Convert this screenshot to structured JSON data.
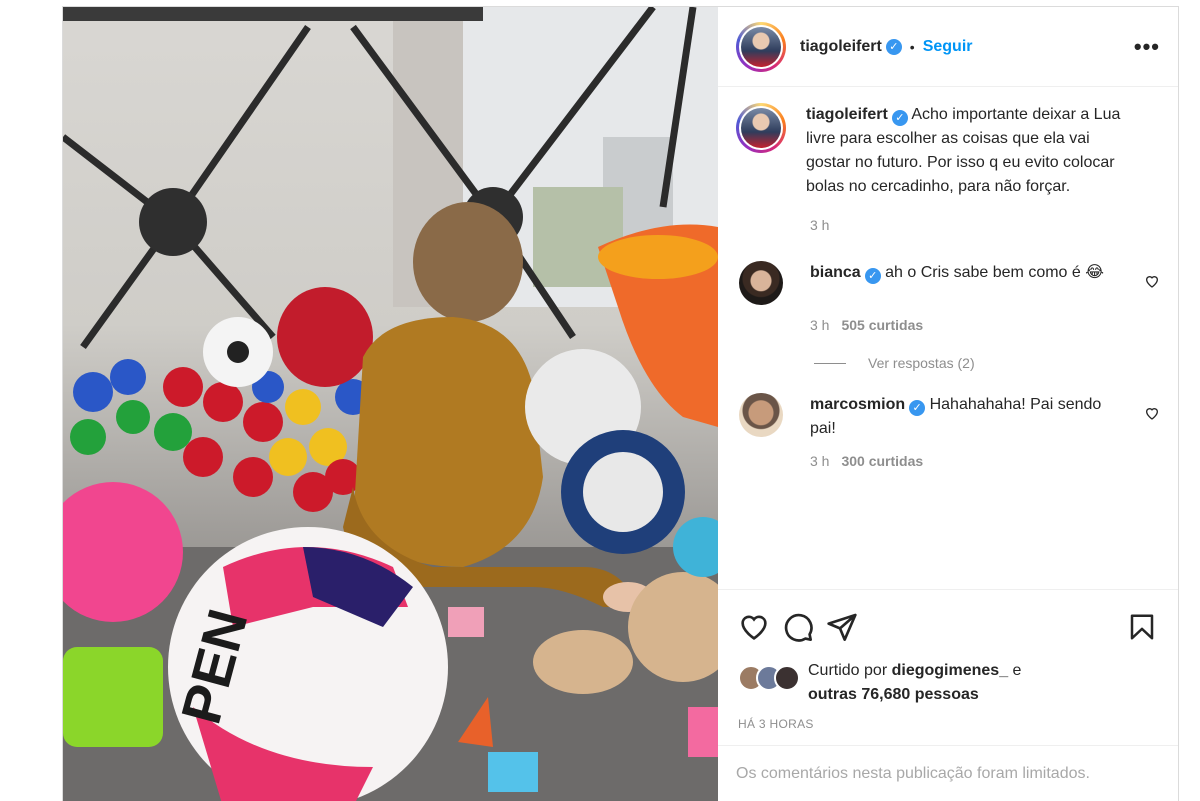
{
  "post": {
    "username": "tiagoleifert",
    "follow_label": "Seguir",
    "dot": "•",
    "more_label": "•••",
    "verified_glyph": "✓"
  },
  "caption": {
    "username": "tiagoleifert",
    "text": "Acho importante deixar a Lua livre para escolher as coisas que ela vai gostar no futuro. Por isso q eu evito colocar bolas no cercadinho, para não forçar.",
    "time": "3 h"
  },
  "comments": [
    {
      "username": "bianca",
      "text": "ah o Cris sabe bem como é 😂",
      "time": "3 h",
      "likes": "505 curtidas"
    },
    {
      "username": "marcosmion",
      "text": "Hahahahaha! Pai sendo pai!",
      "time": "3 h",
      "likes": "300 curtidas"
    }
  ],
  "replies_label": "Ver respostas (2)",
  "likes": {
    "prefix": "Curtido por",
    "user": "diegogimenes_",
    "connector": "e",
    "others": "outras 76,680 pessoas"
  },
  "timestamp": "HÁ 3 HORAS",
  "limited_text": "Os comentários nesta publicação foram limitados.",
  "colors": {
    "link_blue": "#0095f6",
    "verified_blue": "#3897f0",
    "muted_gray": "#8e8e8e"
  },
  "icons": [
    "heart-icon",
    "comment-icon",
    "share-icon",
    "bookmark-icon",
    "more-icon",
    "verified-icon"
  ]
}
